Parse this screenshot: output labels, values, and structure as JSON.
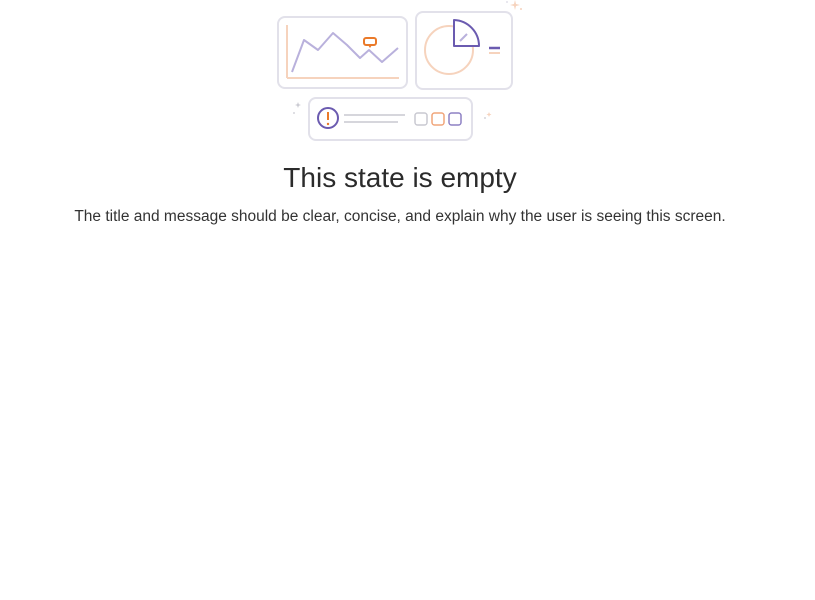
{
  "empty_state": {
    "title": "This state is empty",
    "message": "The title and message should be clear, concise, and explain why the user is seeing this screen."
  },
  "illustration": {
    "icons": [
      "line-chart-card-icon",
      "pie-chart-card-icon",
      "alert-list-card-icon"
    ],
    "colors": {
      "border": "#e2e1ea",
      "purple": "#6b5bb0",
      "purple_light": "#b9b1dc",
      "orange": "#ea7a2a",
      "orange_light": "#f6d3bd",
      "grey_line": "#c9c9d1"
    }
  }
}
